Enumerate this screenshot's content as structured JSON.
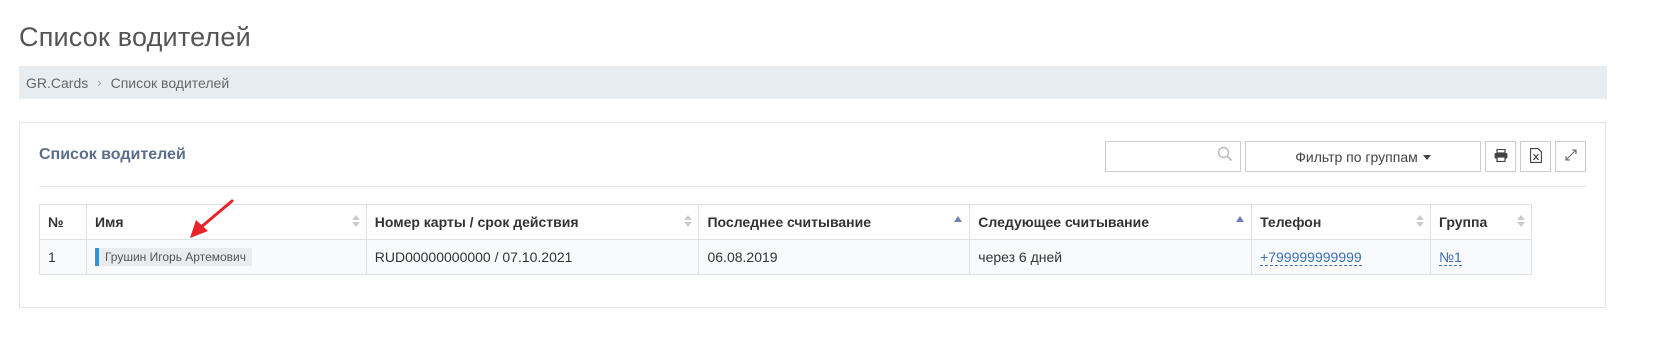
{
  "page": {
    "title": "Список водителей"
  },
  "breadcrumb": {
    "root": "GR.Cards",
    "separator": "›",
    "current": "Список водителей"
  },
  "panel": {
    "title": "Список водителей",
    "search": {
      "value": "",
      "placeholder": ""
    },
    "filter_label": "Фильтр по группам",
    "icons": [
      "print-icon",
      "excel-export-icon",
      "fullscreen-icon"
    ]
  },
  "table": {
    "headers": {
      "num": "№",
      "name": "Имя",
      "card": "Номер карты / срок действия",
      "last_read": "Последнее считывание",
      "next_read": "Следующее считывание",
      "phone": "Телефон",
      "group": "Группа"
    },
    "rows": [
      {
        "num": "1",
        "name": "Грушин Игорь Артемович",
        "card": "RUD00000000000 / 07.10.2021",
        "last_read": "06.08.2019",
        "next_read": "через 6 дней",
        "phone": "+799999999999",
        "group": "№1"
      }
    ]
  },
  "colors": {
    "accent": "#5b6f8c",
    "link": "#3b6fb6",
    "annotation_arrow": "#e8232a",
    "name_marker": "#3a8fd6"
  }
}
